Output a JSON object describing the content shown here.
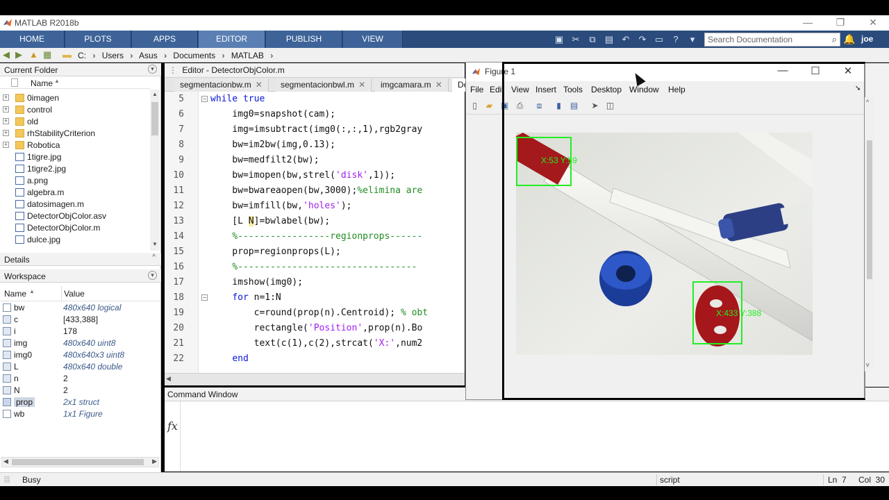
{
  "app": {
    "title": "MATLAB R2018b",
    "brand_color": "#2a4b7c"
  },
  "toolstrip": {
    "tabs": [
      "HOME",
      "PLOTS",
      "APPS",
      "EDITOR",
      "PUBLISH",
      "VIEW"
    ],
    "active_tab": "EDITOR",
    "search_placeholder": "Search Documentation",
    "user": "joe"
  },
  "address_bar": {
    "path": [
      "C:",
      "Users",
      "Asus",
      "Documents",
      "MATLAB"
    ]
  },
  "current_folder": {
    "title": "Current Folder",
    "column": "Name",
    "items": [
      {
        "name": "0imagen",
        "type": "folder"
      },
      {
        "name": "control",
        "type": "folder"
      },
      {
        "name": "old",
        "type": "folder"
      },
      {
        "name": "rhStabilityCriterion",
        "type": "folder"
      },
      {
        "name": "Robotica",
        "type": "folder"
      },
      {
        "name": "1tigre.jpg",
        "type": "image"
      },
      {
        "name": "1tigre2.jpg",
        "type": "image"
      },
      {
        "name": "a.png",
        "type": "image"
      },
      {
        "name": "algebra.m",
        "type": "m"
      },
      {
        "name": "datosimagen.m",
        "type": "m"
      },
      {
        "name": "DetectorObjColor.asv",
        "type": "file"
      },
      {
        "name": "DetectorObjColor.m",
        "type": "m"
      },
      {
        "name": "dulce.jpg",
        "type": "image"
      }
    ]
  },
  "details": {
    "title": "Details"
  },
  "workspace": {
    "title": "Workspace",
    "columns": [
      "Name",
      "Value"
    ],
    "rows": [
      {
        "name": "bw",
        "value": "480x640 logical",
        "italic": true
      },
      {
        "name": "c",
        "value": "[433,388]",
        "italic": false
      },
      {
        "name": "i",
        "value": "178",
        "italic": false
      },
      {
        "name": "img",
        "value": "480x640 uint8",
        "italic": true
      },
      {
        "name": "img0",
        "value": "480x640x3 uint8",
        "italic": true
      },
      {
        "name": "L",
        "value": "480x640 double",
        "italic": true
      },
      {
        "name": "n",
        "value": "2",
        "italic": false
      },
      {
        "name": "N",
        "value": "2",
        "italic": false
      },
      {
        "name": "prop",
        "value": "2x1 struct",
        "italic": true
      },
      {
        "name": "wb",
        "value": "1x1 Figure",
        "italic": true
      }
    ]
  },
  "editor": {
    "title": "Editor - DetectorObjColor.m",
    "tabs": [
      "segmentacionbw.m",
      "segmentacionbwl.m",
      "imgcamara.m",
      "De"
    ],
    "lines": [
      {
        "n": "5",
        "code": "while true"
      },
      {
        "n": "6",
        "code": "    img0=snapshot(cam);"
      },
      {
        "n": "7",
        "code": "    img=imsubtract(img0(:,:,1),rgb2gray"
      },
      {
        "n": "8",
        "code": "    bw=im2bw(img,0.13);"
      },
      {
        "n": "9",
        "code": "    bw=medfilt2(bw);"
      },
      {
        "n": "10",
        "code": "    bw=imopen(bw,strel('disk',1));"
      },
      {
        "n": "11",
        "code": "    bw=bwareaopen(bw,3000);%elimina are"
      },
      {
        "n": "12",
        "code": "    bw=imfill(bw,'holes');"
      },
      {
        "n": "13",
        "code": "    [L N]=bwlabel(bw);"
      },
      {
        "n": "14",
        "code": "    %-----------------regionprops------"
      },
      {
        "n": "15",
        "code": "    prop=regionprops(L);"
      },
      {
        "n": "16",
        "code": "    %---------------------------------"
      },
      {
        "n": "17",
        "code": "    imshow(img0);"
      },
      {
        "n": "18",
        "code": "    for n=1:N"
      },
      {
        "n": "19",
        "code": "        c=round(prop(n).Centroid); % obt"
      },
      {
        "n": "20",
        "code": "        rectangle('Position',prop(n).Bo"
      },
      {
        "n": "21",
        "code": "        text(c(1),c(2),strcat('X:',num2"
      },
      {
        "n": "22",
        "code": "    end"
      }
    ]
  },
  "command_window": {
    "title": "Command Window",
    "prompt": "fx"
  },
  "figure": {
    "title": "Figure 1",
    "menu": [
      "File",
      "Edit",
      "View",
      "Insert",
      "Tools",
      "Desktop",
      "Window",
      "Help"
    ],
    "labels": [
      "X:53 Y:59",
      "X:433 Y:388"
    ]
  },
  "status": {
    "busy": "Busy",
    "script": "script",
    "ln": "Ln  7",
    "col": "Col  30"
  }
}
